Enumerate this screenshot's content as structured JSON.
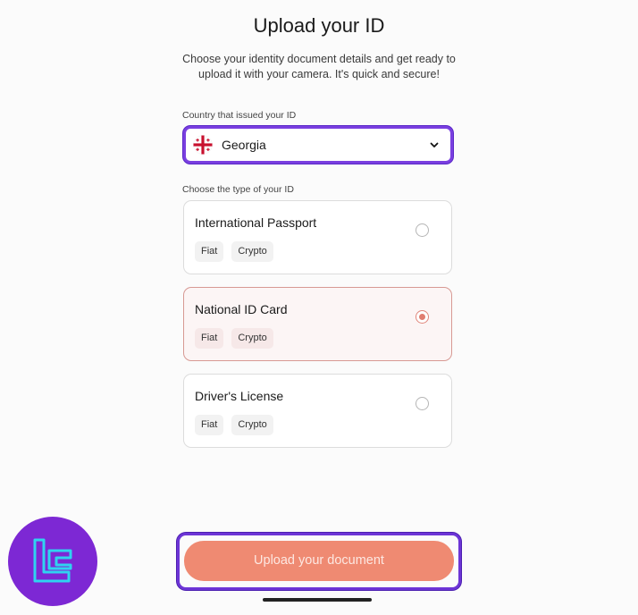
{
  "header": {
    "title": "Upload your ID",
    "subtitle": "Choose your identity document details and get ready to upload it with your camera. It's quick and secure!"
  },
  "country": {
    "label": "Country that issued your ID",
    "selected": "Georgia",
    "flag_icon": "georgia-flag-icon",
    "dropdown_icon": "chevron-down-icon"
  },
  "id_type": {
    "label": "Choose the type of your ID",
    "options": [
      {
        "title": "International Passport",
        "tags": [
          "Fiat",
          "Crypto"
        ],
        "selected": false
      },
      {
        "title": "National ID Card",
        "tags": [
          "Fiat",
          "Crypto"
        ],
        "selected": true
      },
      {
        "title": "Driver's License",
        "tags": [
          "Fiat",
          "Crypto"
        ],
        "selected": false
      }
    ]
  },
  "actions": {
    "upload_label": "Upload your document"
  },
  "colors": {
    "accent": "#ef8a72",
    "highlight": "#7a3fe0",
    "selected_border": "#d79993",
    "logo_bg": "#7d28d4",
    "logo_fg": "#2fd3f0"
  }
}
